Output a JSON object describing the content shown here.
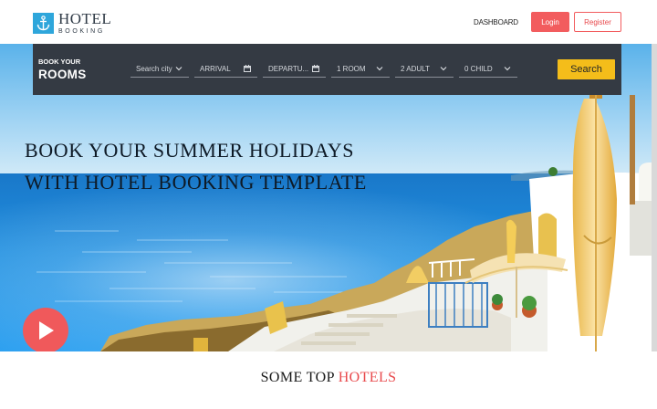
{
  "header": {
    "logo_line1": "HOTEL",
    "logo_line2": "BOOKING",
    "logo_icon": "anchor-icon",
    "dashboard_label": "DASHBOARD",
    "login_label": "Login",
    "register_label": "Register"
  },
  "booking": {
    "label_line1": "BOOK YOUR",
    "label_line2": "ROOMS",
    "fields": [
      {
        "value": "Search city",
        "icon": "chevron-down-icon"
      },
      {
        "value": "ARRIVAL",
        "icon": "calendar-icon"
      },
      {
        "value": "DEPARTU...",
        "icon": "calendar-icon"
      },
      {
        "value": "1 ROOM",
        "icon": "chevron-down-icon"
      },
      {
        "value": "2 ADULT",
        "icon": "chevron-down-icon"
      },
      {
        "value": "0 CHILD",
        "icon": "chevron-down-icon"
      }
    ],
    "search_label": "Search"
  },
  "hero": {
    "title_line1": "BOOK YOUR SUMMER HOLIDAYS",
    "title_line2": "WITH HOTEL BOOKING TEMPLATE",
    "play_icon": "play-icon"
  },
  "section": {
    "title_prefix": "SOME TOP ",
    "title_accent": "HOTELS"
  },
  "colors": {
    "accent": "#f25c5e",
    "bar": "#343a43",
    "search": "#f4bd1a",
    "logo": "#2ea6db"
  }
}
